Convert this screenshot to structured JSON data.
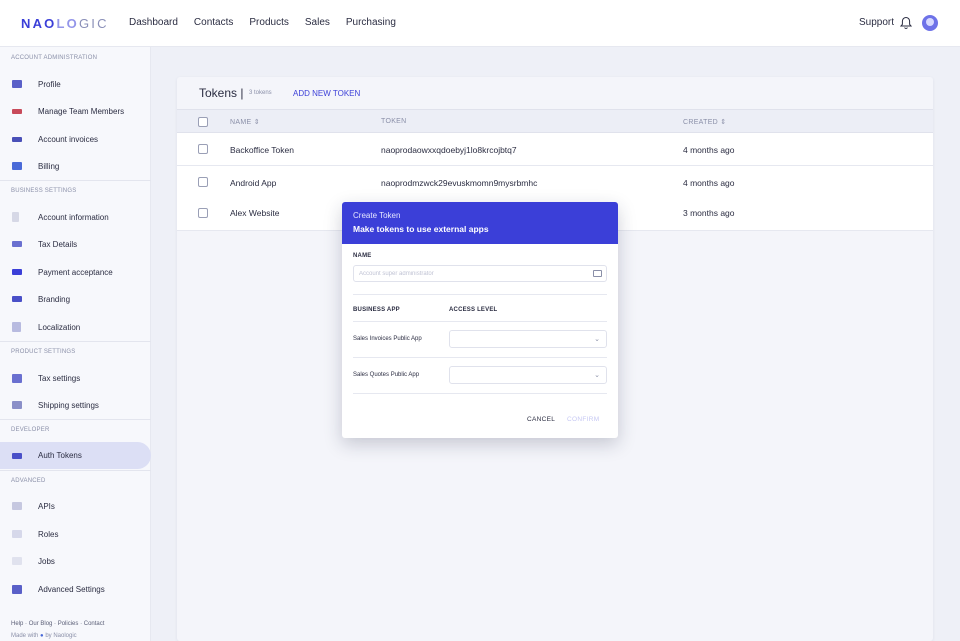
{
  "header": {
    "logo": {
      "part1": "NAO",
      "part2": "LO",
      "part3": "GIC"
    },
    "nav": [
      "Dashboard",
      "Contacts",
      "Products",
      "Sales",
      "Purchasing"
    ],
    "support": "Support"
  },
  "sidebar": {
    "sections": {
      "account": "ACCOUNT ADMINISTRATION",
      "business": "BUSINESS SETTINGS",
      "product": "PRODUCT SETTINGS",
      "developer": "DEVELOPER",
      "advanced": "ADVANCED"
    },
    "items": [
      {
        "label": "Profile",
        "icon": "profile-icon"
      },
      {
        "label": "Manage Team Members",
        "icon": "team-icon"
      },
      {
        "label": "Account invoices",
        "icon": "invoice-icon"
      },
      {
        "label": "Billing",
        "icon": "billing-icon"
      },
      {
        "label": "Account information",
        "icon": "info-icon"
      },
      {
        "label": "Tax Details",
        "icon": "tax-icon"
      },
      {
        "label": "Payment acceptance",
        "icon": "payment-icon"
      },
      {
        "label": "Branding",
        "icon": "branding-icon"
      },
      {
        "label": "Localization",
        "icon": "localization-icon"
      },
      {
        "label": "Tax settings",
        "icon": "tax-settings-icon"
      },
      {
        "label": "Shipping settings",
        "icon": "cart-icon"
      },
      {
        "label": "Auth Tokens",
        "icon": "token-icon"
      },
      {
        "label": "APIs",
        "icon": "api-icon"
      },
      {
        "label": "Roles",
        "icon": "roles-icon"
      },
      {
        "label": "Jobs",
        "icon": "jobs-icon"
      },
      {
        "label": "Advanced Settings",
        "icon": "advanced-icon"
      }
    ],
    "footer": {
      "help": "Help",
      "blog": "Our Blog",
      "policies": "Policies",
      "contact": "Contact",
      "made": "Made with",
      "by": "by Naologic"
    }
  },
  "tokens": {
    "title": "Tokens",
    "count": "3 tokens",
    "add": "ADD NEW TOKEN",
    "columns": {
      "name": "NAME",
      "token": "TOKEN",
      "created": "CREATED"
    },
    "rows": [
      {
        "name": "Backoffice Token",
        "token": "naoprodaowxxqdoebyj1lo8krcojbtq7",
        "created": "4 months ago"
      },
      {
        "name": "Android App",
        "token": "naoprodmzwck29evuskmomn9mysrbmhc",
        "created": "4 months ago"
      },
      {
        "name": "Alex Website",
        "token": "",
        "created": "3 months ago"
      }
    ]
  },
  "modal": {
    "title": "Create Token",
    "subtitle": "Make tokens to use external apps",
    "name_label": "NAME",
    "name_placeholder": "Account super administrator",
    "name_value": "",
    "col_app": "BUSINESS APP",
    "col_access": "ACCESS LEVEL",
    "apps": [
      {
        "name": "Sales Invoices Public App",
        "access": ""
      },
      {
        "name": "Sales Quotes Public App",
        "access": ""
      }
    ],
    "cancel": "CANCEL",
    "confirm": "CONFIRM"
  },
  "colors": {
    "accent": "#3b3fd8",
    "active_bg": "#dcdff5",
    "confirm_disabled": "#c6c8f3"
  }
}
